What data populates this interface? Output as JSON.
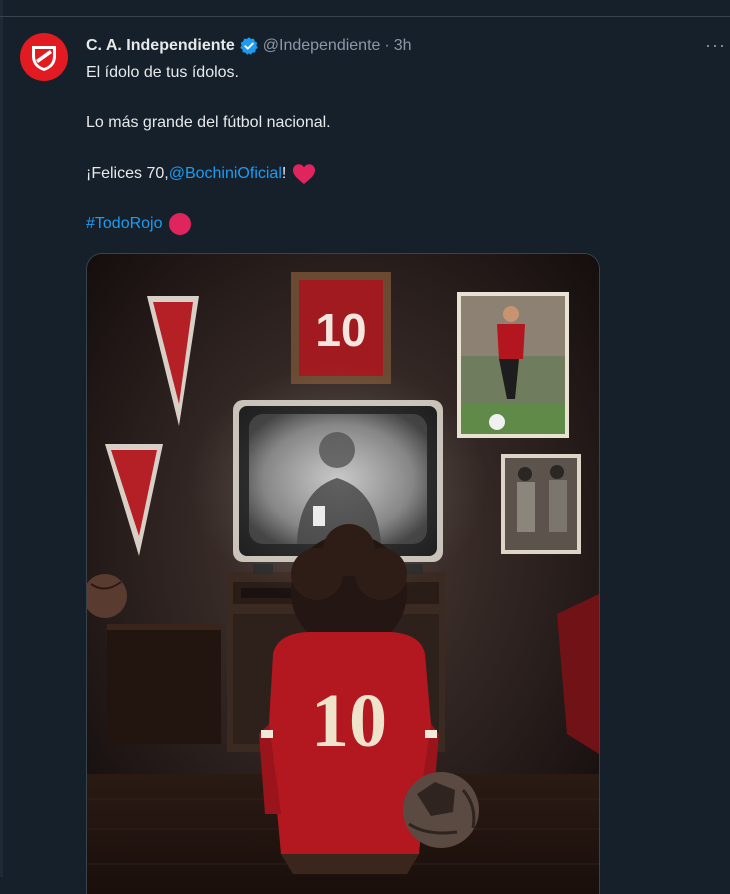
{
  "tweet": {
    "display_name": "C. A. Independiente",
    "handle": "@Independiente",
    "separator": "·",
    "time": "3h",
    "more": "···",
    "line1": "El ídolo de tus ídolos.",
    "line2": "Lo más grande del fútbol nacional.",
    "line3_prefix": "¡Felices 70, ",
    "mention": "@BochiniOficial",
    "line3_suffix": "!",
    "hashtag": "#TodoRojo"
  },
  "media": {
    "frame_number": "10",
    "shirt_number": "10"
  },
  "colors": {
    "background": "#15202b",
    "link": "#1d9bf0",
    "verified": "#1d9bf0",
    "heart": "#f91880",
    "club_red": "#e21b22"
  },
  "icons": [
    "club-crest-icon",
    "verified-badge-icon",
    "more-options-icon",
    "red-heart-icon",
    "red-circle-icon"
  ]
}
